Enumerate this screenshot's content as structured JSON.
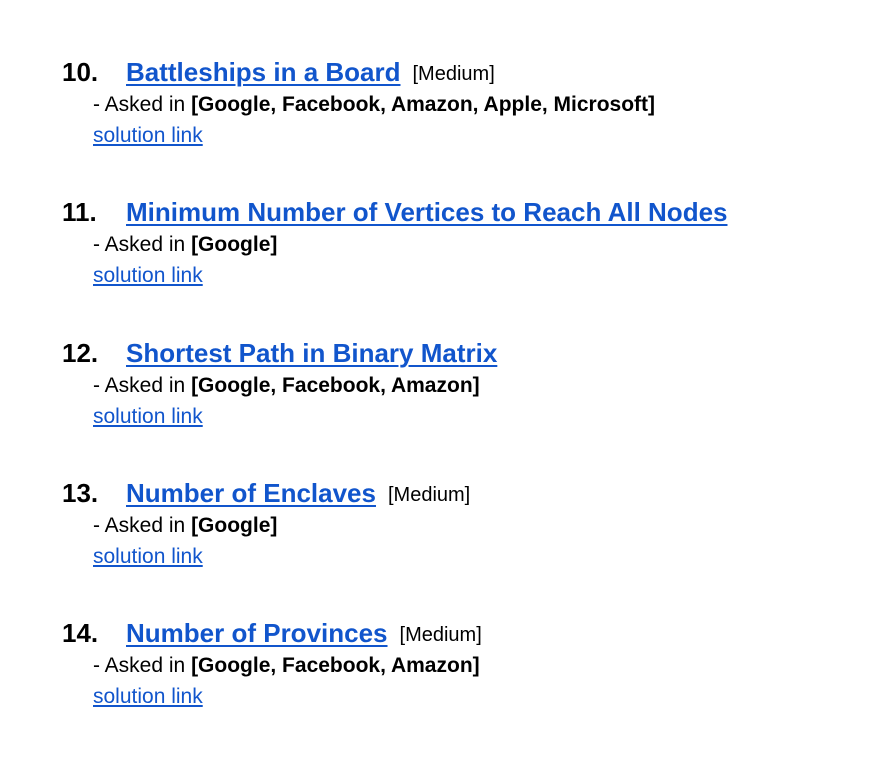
{
  "problems": [
    {
      "number": "10.",
      "title": "Battleships in a Board",
      "difficulty": "[Medium]",
      "asked_prefix": "- Asked in ",
      "companies": "[Google, Facebook, Amazon, Apple, Microsoft]",
      "solution_label": "solution link"
    },
    {
      "number": "11.",
      "title": "Minimum Number of Vertices to Reach All Nodes",
      "difficulty": "",
      "asked_prefix": "- Asked in ",
      "companies": "[Google]",
      "solution_label": "solution link"
    },
    {
      "number": "12.",
      "title": "Shortest Path in Binary Matrix",
      "difficulty": "",
      "asked_prefix": "- Asked in ",
      "companies": "[Google, Facebook, Amazon]",
      "solution_label": "solution link"
    },
    {
      "number": "13.",
      "title": "Number of Enclaves",
      "difficulty": "[Medium]",
      "asked_prefix": "- Asked in ",
      "companies": "[Google]",
      "solution_label": "solution link"
    },
    {
      "number": "14.",
      "title": "Number of Provinces",
      "difficulty": "[Medium]",
      "asked_prefix": "- Asked in ",
      "companies": "[Google, Facebook, Amazon]",
      "solution_label": "solution link"
    }
  ],
  "colors": {
    "link": "#1155cc",
    "text": "#000000",
    "background": "#ffffff"
  }
}
